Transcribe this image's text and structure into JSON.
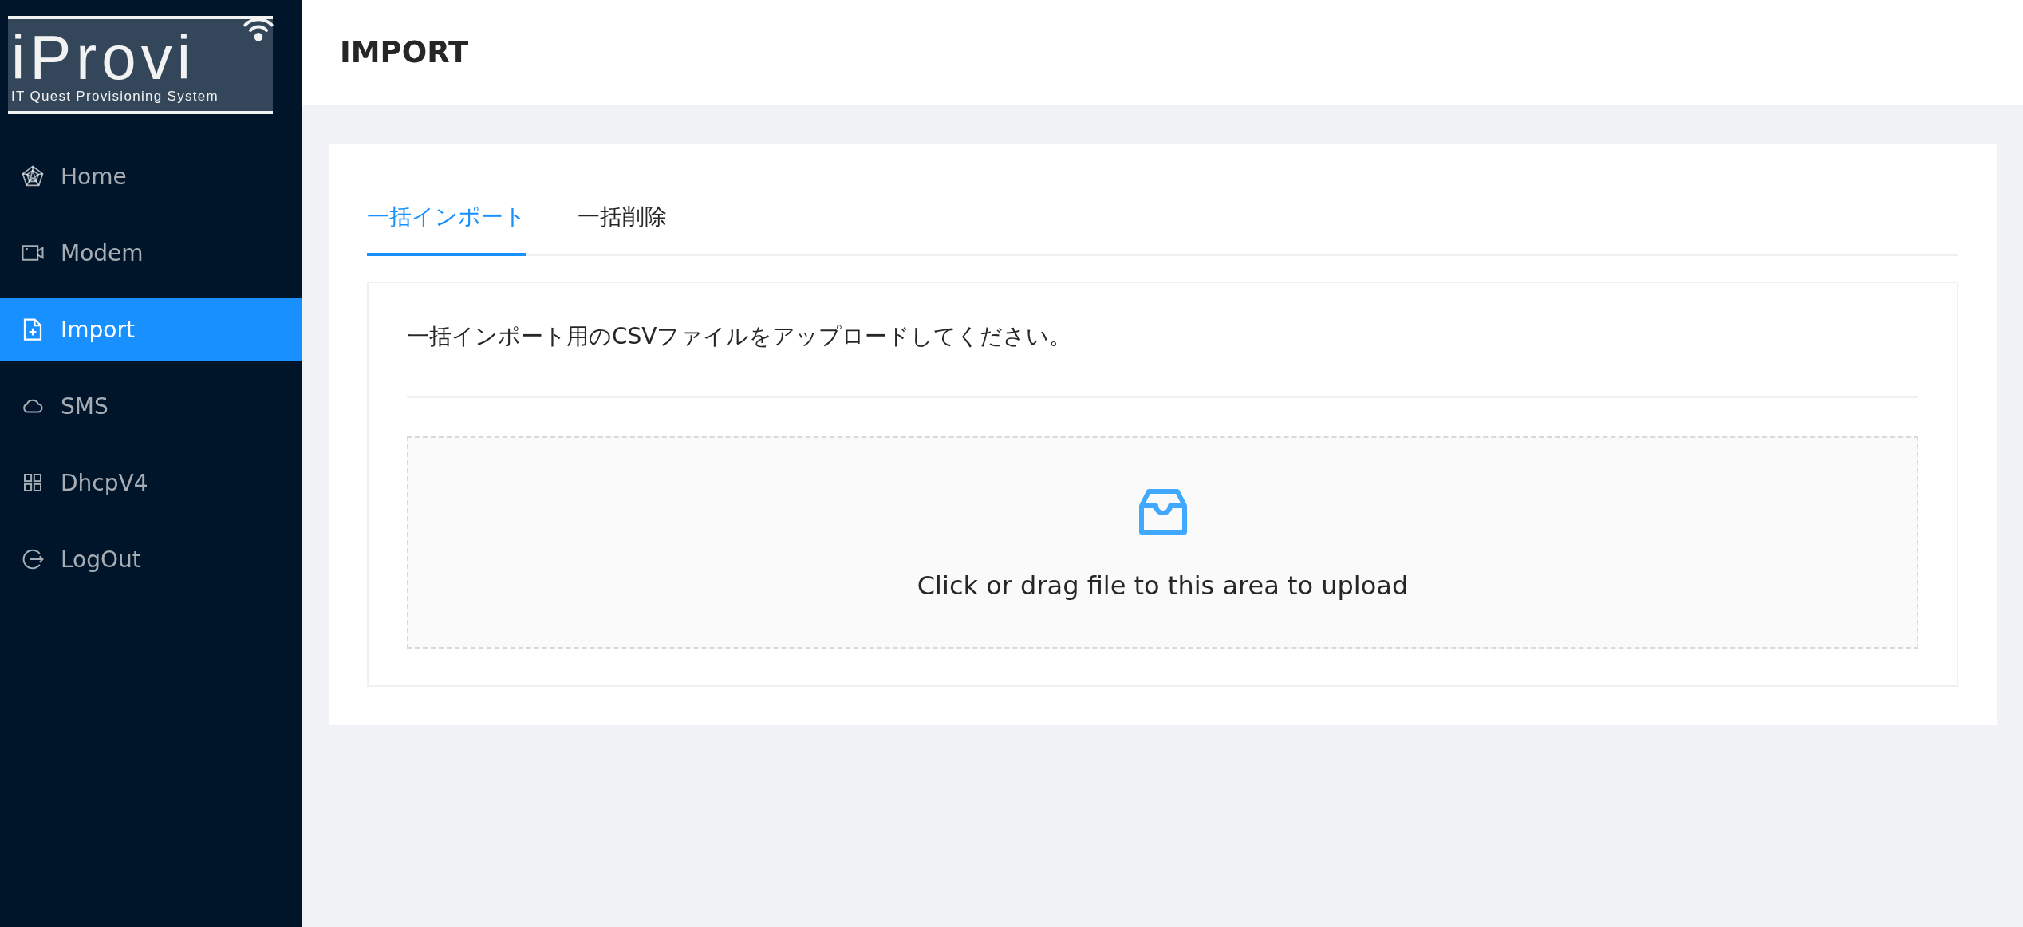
{
  "logo": {
    "name": "iProvi",
    "subtitle": "IT Quest Provisioning System"
  },
  "sidebar": {
    "items": [
      {
        "label": "Home",
        "selected": false
      },
      {
        "label": "Modem",
        "selected": false
      },
      {
        "label": "Import",
        "selected": true
      },
      {
        "label": "SMS",
        "selected": false
      },
      {
        "label": "DhcpV4",
        "selected": false
      },
      {
        "label": "LogOut",
        "selected": false
      }
    ]
  },
  "header": {
    "title": "IMPORT"
  },
  "tabs": [
    {
      "label": "一括インポート",
      "selected": true
    },
    {
      "label": "一括削除",
      "selected": false
    }
  ],
  "panel": {
    "instruction": "一括インポート用のCSVファイルをアップロードしてください。",
    "upload": {
      "hint": "Click or drag file to this area to upload"
    }
  }
}
